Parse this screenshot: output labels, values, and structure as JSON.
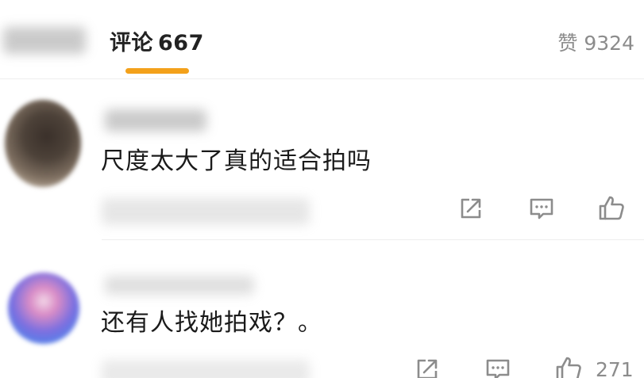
{
  "tabs": {
    "comments_label": "评论",
    "comments_count": "667",
    "likes_label": "赞",
    "likes_count": "9324"
  },
  "colors": {
    "accent": "#f3a11b",
    "icon": "#8c8c8c",
    "text": "#1a1a1a"
  },
  "comments": [
    {
      "text": "尺度太大了真的适合拍吗",
      "actions": [
        "share-icon",
        "reply-icon",
        "like-icon"
      ]
    },
    {
      "text": "还有人找她拍戏？。",
      "like_count": "271",
      "actions": [
        "share-icon",
        "reply-icon",
        "like-icon"
      ]
    }
  ]
}
